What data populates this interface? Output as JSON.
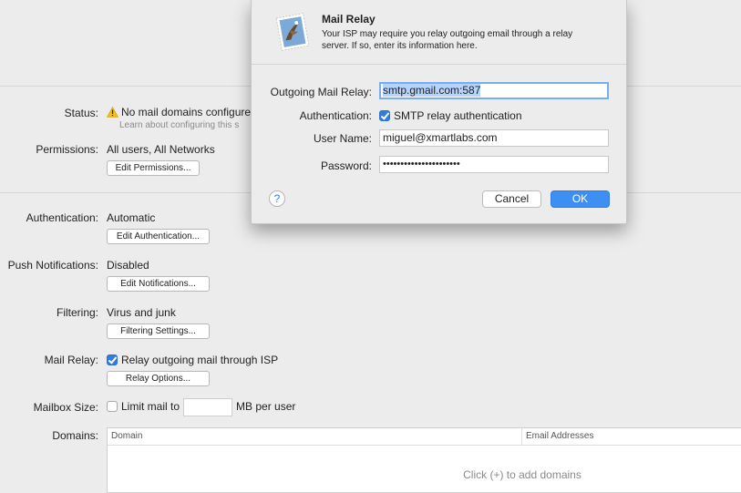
{
  "main": {
    "status": {
      "label": "Status:",
      "value": "No mail domains configure",
      "sub": "Learn about configuring this s"
    },
    "permissions": {
      "label": "Permissions:",
      "value": "All users, All Networks",
      "button": "Edit Permissions..."
    },
    "authentication": {
      "label": "Authentication:",
      "value": "Automatic",
      "button": "Edit Authentication..."
    },
    "push": {
      "label": "Push Notifications:",
      "value": "Disabled",
      "button": "Edit Notifications..."
    },
    "filtering": {
      "label": "Filtering:",
      "value": "Virus and junk",
      "button": "Filtering Settings..."
    },
    "relay": {
      "label": "Mail Relay:",
      "checkbox_label": "Relay outgoing mail through ISP",
      "checked": true,
      "button": "Relay Options..."
    },
    "mailbox": {
      "label": "Mailbox Size:",
      "checkbox_label": "Limit mail to",
      "checked": false,
      "value": "",
      "unit": "MB per user"
    },
    "domains": {
      "label": "Domains:",
      "columns": [
        "Domain",
        "Email Addresses"
      ],
      "hint": "Click (+) to add domains"
    }
  },
  "sheet": {
    "title": "Mail Relay",
    "description": "Your ISP may require you relay outgoing email through a relay server. If so, enter its information here.",
    "icon": "mail-stamp-icon",
    "relay_label": "Outgoing Mail Relay:",
    "relay_value": "smtp.gmail.com:587",
    "auth_label": "Authentication:",
    "auth_checkbox": "SMTP relay authentication",
    "auth_checked": true,
    "user_label": "User Name:",
    "user_value": "miguel@xmartlabs.com",
    "pass_label": "Password:",
    "pass_value": "••••••••••••••••••••••",
    "help": "?",
    "cancel": "Cancel",
    "ok": "OK"
  },
  "colors": {
    "accent": "#3d8ff3",
    "selection": "#b4d4fe",
    "warning": "#f5c012"
  }
}
